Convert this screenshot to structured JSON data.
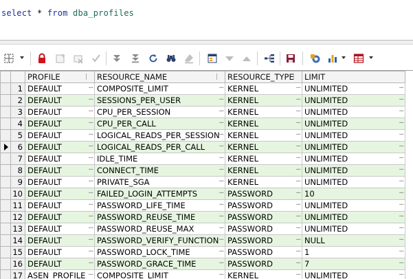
{
  "editor": {
    "kw_select": "select",
    "op_star": "*",
    "kw_from": "from",
    "table_name": "dba_profiles"
  },
  "toolbar": {
    "icons": [
      "grid-select-icon",
      "lock-icon",
      "insert-record-icon",
      "delete-record-icon",
      "post-changes-icon",
      "fetch-next-page-icon",
      "fetch-last-page-icon",
      "refresh-icon",
      "find-icon",
      "clear-icon",
      "query-by-example-icon",
      "filter-icon",
      "sort-up-icon",
      "exact-query-icon",
      "save-icon",
      "export-icon",
      "chart-icon",
      "single-record-view-icon"
    ]
  },
  "grid": {
    "columns": [
      "PROFILE",
      "RESOURCE_NAME",
      "RESOURCE_TYPE",
      "LIMIT"
    ],
    "current_row": 6,
    "rows": [
      {
        "n": "1",
        "profile": "DEFAULT",
        "resource": "COMPOSITE_LIMIT",
        "type": "KERNEL",
        "limit": "UNLIMITED"
      },
      {
        "n": "2",
        "profile": "DEFAULT",
        "resource": "SESSIONS_PER_USER",
        "type": "KERNEL",
        "limit": "UNLIMITED"
      },
      {
        "n": "3",
        "profile": "DEFAULT",
        "resource": "CPU_PER_SESSION",
        "type": "KERNEL",
        "limit": "UNLIMITED"
      },
      {
        "n": "4",
        "profile": "DEFAULT",
        "resource": "CPU_PER_CALL",
        "type": "KERNEL",
        "limit": "UNLIMITED"
      },
      {
        "n": "5",
        "profile": "DEFAULT",
        "resource": "LOGICAL_READS_PER_SESSION",
        "type": "KERNEL",
        "limit": "UNLIMITED"
      },
      {
        "n": "6",
        "profile": "DEFAULT",
        "resource": "LOGICAL_READS_PER_CALL",
        "type": "KERNEL",
        "limit": "UNLIMITED"
      },
      {
        "n": "7",
        "profile": "DEFAULT",
        "resource": "IDLE_TIME",
        "type": "KERNEL",
        "limit": "UNLIMITED"
      },
      {
        "n": "8",
        "profile": "DEFAULT",
        "resource": "CONNECT_TIME",
        "type": "KERNEL",
        "limit": "UNLIMITED"
      },
      {
        "n": "9",
        "profile": "DEFAULT",
        "resource": "PRIVATE_SGA",
        "type": "KERNEL",
        "limit": "UNLIMITED"
      },
      {
        "n": "10",
        "profile": "DEFAULT",
        "resource": "FAILED_LOGIN_ATTEMPTS",
        "type": "PASSWORD",
        "limit": "10"
      },
      {
        "n": "11",
        "profile": "DEFAULT",
        "resource": "PASSWORD_LIFE_TIME",
        "type": "PASSWORD",
        "limit": "UNLIMITED"
      },
      {
        "n": "12",
        "profile": "DEFAULT",
        "resource": "PASSWORD_REUSE_TIME",
        "type": "PASSWORD",
        "limit": "UNLIMITED"
      },
      {
        "n": "13",
        "profile": "DEFAULT",
        "resource": "PASSWORD_REUSE_MAX",
        "type": "PASSWORD",
        "limit": "UNLIMITED"
      },
      {
        "n": "14",
        "profile": "DEFAULT",
        "resource": "PASSWORD_VERIFY_FUNCTION",
        "type": "PASSWORD",
        "limit": "NULL"
      },
      {
        "n": "15",
        "profile": "DEFAULT",
        "resource": "PASSWORD_LOCK_TIME",
        "type": "PASSWORD",
        "limit": "1"
      },
      {
        "n": "16",
        "profile": "DEFAULT",
        "resource": "PASSWORD_GRACE_TIME",
        "type": "PASSWORD",
        "limit": "7"
      },
      {
        "n": "17",
        "profile": "ASEN_PROFILE",
        "resource": "COMPOSITE_LIMIT",
        "type": "KERNEL",
        "limit": "UNLIMITED"
      }
    ]
  }
}
